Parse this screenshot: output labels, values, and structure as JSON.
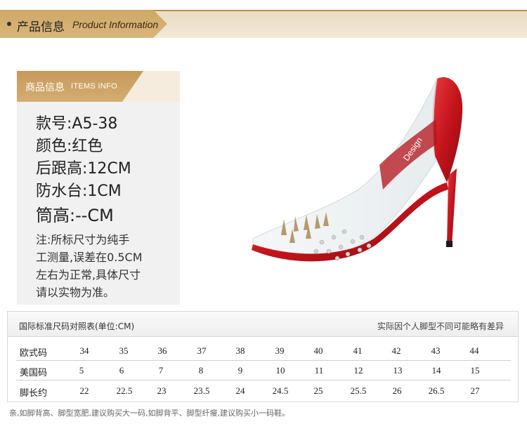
{
  "header": {
    "title_cn": "产品信息",
    "title_en": "Product Information"
  },
  "info": {
    "title_cn": "商品信息",
    "title_en": "ITEMS INFO",
    "model": "款号:A5-38",
    "color": "颜色:红色",
    "heel": "后跟高:12CM",
    "platform": "防水台:1CM",
    "shaft": "筒高:--CM",
    "note_lines": [
      "注:所标尺寸为纯手",
      "工测量,误差在0.5CM",
      "左右为正常,具体尺寸",
      "请以实物为准。"
    ]
  },
  "shoe": {
    "brand_text": "Design",
    "colors": {
      "patent": "#c4131b",
      "clear": "#e8eef0",
      "sole": "#1a1a1a"
    }
  },
  "size_table": {
    "title": "国际标准尺码对照表(单位:CM)",
    "note": "实际因个人脚型不同可能略有差异",
    "rows": [
      {
        "label": "欧式码",
        "values": [
          "34",
          "35",
          "36",
          "37",
          "38",
          "39",
          "40",
          "41",
          "42",
          "43",
          "44"
        ]
      },
      {
        "label": "美国码",
        "values": [
          "5",
          "6",
          "7",
          "8",
          "9",
          "10",
          "11",
          "12",
          "13",
          "14",
          "15"
        ]
      },
      {
        "label": "脚长约",
        "values": [
          "22",
          "22.5",
          "23",
          "23.5",
          "24",
          "24.5",
          "25",
          "25.5",
          "26",
          "26.5",
          "27"
        ]
      }
    ]
  },
  "footer": "亲,如脚背高、脚型宽肥,建议购买大一码,如脚背平、脚型纤瘦,建议购买小一码鞋。",
  "colors": {
    "accent": "#cfa866",
    "panel": "#f1f1f1"
  }
}
